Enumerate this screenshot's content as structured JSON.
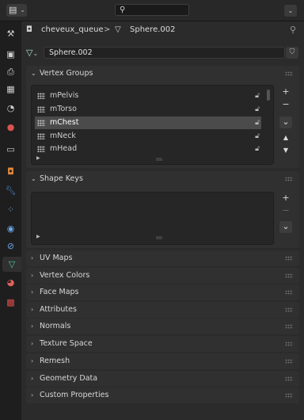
{
  "header": {
    "editor_type_icon": "properties-editor-icon",
    "search": {
      "value": "",
      "placeholder": ""
    }
  },
  "tabs": [
    {
      "name": "tool-tab",
      "icon": "wrench-screwdriver-icon"
    },
    {
      "name": "render-tab",
      "icon": "camera-back-icon"
    },
    {
      "name": "output-tab",
      "icon": "printer-icon"
    },
    {
      "name": "view-layer-tab",
      "icon": "image-stack-icon"
    },
    {
      "name": "scene-tab",
      "icon": "scene-icon"
    },
    {
      "name": "world-tab",
      "icon": "world-icon"
    },
    {
      "name": "collection-tab",
      "icon": "collection-box-icon"
    },
    {
      "name": "object-tab",
      "icon": "object-square-icon"
    },
    {
      "name": "modifiers-tab",
      "icon": "wrench-icon"
    },
    {
      "name": "particles-tab",
      "icon": "particles-icon"
    },
    {
      "name": "physics-tab",
      "icon": "physics-orbit-icon"
    },
    {
      "name": "constraints-tab",
      "icon": "constraint-icon"
    },
    {
      "name": "data-tab",
      "icon": "mesh-data-icon",
      "active": true
    },
    {
      "name": "material-tab",
      "icon": "material-sphere-icon"
    },
    {
      "name": "texture-tab",
      "icon": "checker-texture-icon"
    }
  ],
  "breadcrumb": {
    "object_name": "cheveux_queue",
    "separator": ">",
    "mesh_name": "Sphere.002"
  },
  "data_block": {
    "name": "Sphere.002"
  },
  "vertex_groups": {
    "title": "Vertex Groups",
    "items": [
      {
        "label": "mPelvis",
        "selected": false
      },
      {
        "label": "mTorso",
        "selected": false
      },
      {
        "label": "mChest",
        "selected": true
      },
      {
        "label": "mNeck",
        "selected": false
      },
      {
        "label": "mHead",
        "selected": false
      }
    ],
    "buttons": {
      "add": "+",
      "remove": "−",
      "menu": "⌄",
      "move_up": "▲",
      "move_down": "▼"
    }
  },
  "shape_keys": {
    "title": "Shape Keys",
    "buttons": {
      "add": "+",
      "remove": "−",
      "menu": "⌄"
    }
  },
  "collapsed_panels": [
    "UV Maps",
    "Vertex Colors",
    "Face Maps",
    "Attributes",
    "Normals",
    "Texture Space",
    "Remesh",
    "Geometry Data",
    "Custom Properties"
  ],
  "colors": {
    "background": "#2b2b2b",
    "panel": "#303030",
    "selected_row": "#4b4b4b",
    "data_tab_accent": "#4ec9a4",
    "object_tab_accent": "#e08a3a",
    "modifier_tab_accent": "#4f8fd6"
  }
}
